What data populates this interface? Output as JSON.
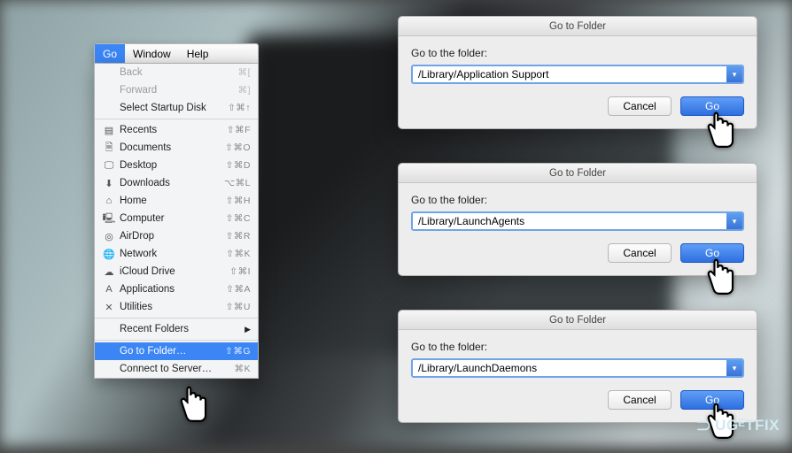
{
  "menubar": {
    "active": "Go",
    "items": [
      "Go",
      "Window",
      "Help"
    ]
  },
  "menu": {
    "back": {
      "label": "Back",
      "shortcut": "⌘["
    },
    "forward": {
      "label": "Forward",
      "shortcut": "⌘]"
    },
    "startup": {
      "label": "Select Startup Disk",
      "shortcut": "⇧⌘↑"
    },
    "recents": {
      "label": "Recents",
      "shortcut": "⇧⌘F"
    },
    "documents": {
      "label": "Documents",
      "shortcut": "⇧⌘O"
    },
    "desktop": {
      "label": "Desktop",
      "shortcut": "⇧⌘D"
    },
    "downloads": {
      "label": "Downloads",
      "shortcut": "⌥⌘L"
    },
    "home": {
      "label": "Home",
      "shortcut": "⇧⌘H"
    },
    "computer": {
      "label": "Computer",
      "shortcut": "⇧⌘C"
    },
    "airdrop": {
      "label": "AirDrop",
      "shortcut": "⇧⌘R"
    },
    "network": {
      "label": "Network",
      "shortcut": "⇧⌘K"
    },
    "icloud": {
      "label": "iCloud Drive",
      "shortcut": "⇧⌘I"
    },
    "applications": {
      "label": "Applications",
      "shortcut": "⇧⌘A"
    },
    "utilities": {
      "label": "Utilities",
      "shortcut": "⇧⌘U"
    },
    "recent_folders": {
      "label": "Recent Folders"
    },
    "goto": {
      "label": "Go to Folder…",
      "shortcut": "⇧⌘G"
    },
    "connect": {
      "label": "Connect to Server…",
      "shortcut": "⌘K"
    }
  },
  "dialog": {
    "title": "Go to Folder",
    "prompt": "Go to the folder:",
    "cancel": "Cancel",
    "go": "Go"
  },
  "paths": {
    "d1": "/Library/Application Support",
    "d2": "/Library/LaunchAgents",
    "d3": "/Library/LaunchDaemons"
  },
  "watermark": "UGᴱTFIX"
}
